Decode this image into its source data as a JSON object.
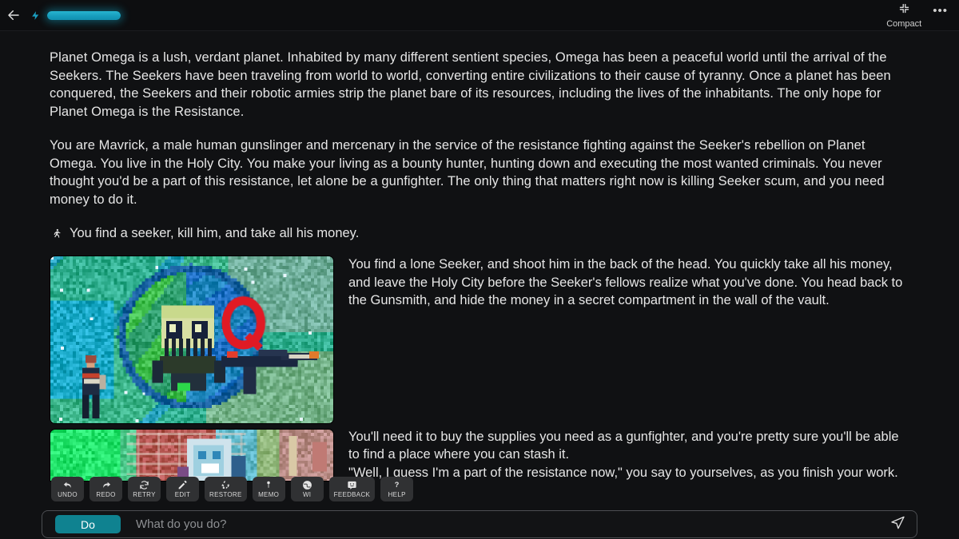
{
  "topbar": {
    "back_icon": "arrow-left-icon",
    "energy_icon": "lightning-bolt-icon",
    "energy_percent": 100,
    "compact_label": "Compact",
    "compact_icon": "compress-icon",
    "more_label": "•••"
  },
  "story": {
    "paragraph_1": "Planet Omega is a lush, verdant planet. Inhabited by many different sentient species, Omega has been a peaceful world until the arrival of the Seekers. The Seekers have been traveling from world to world, converting entire civilizations to their cause of tyranny. Once a planet has been conquered, the Seekers and their robotic armies strip the planet bare of its resources, including the lives of the inhabitants. The only hope for Planet Omega is the Resistance.",
    "paragraph_2": "You are Mavrick, a male human gunslinger and mercenary in the service of the resistance fighting against the Seeker's rebellion on Planet Omega. You live in the Holy City. You make your living as a bounty hunter, hunting down and executing the most wanted criminals. You never thought you'd be a part of this resistance, let alone be a gunfighter. The only thing that matters right now is killing Seeker scum, and you need money to do it.",
    "action_icon": "running-person-icon",
    "action_text": "You find a seeker, kill him, and take all his money.",
    "response_1": "You find a lone Seeker, and shoot him in the back of the head. You quickly take all his money, and leave the Holy City before the Seeker's fellows realize what you've done. You head back to the Gunsmith, and hide the money in a secret compartment in the wall of the vault.",
    "response_2": " You'll need it to buy the supplies you need as a gunfighter, and you're pretty sure you'll be able to find a place where you can stash it.",
    "response_3": "\"Well, I guess I'm a part of the resistance now,\" you say to yourselves, as you finish your work.",
    "image_1_alt": "pixel-art planet with skull face, red Q, gun and standing figure",
    "image_2_alt": "pixel-art scene with green field, brick wall and figure"
  },
  "toolbar": {
    "buttons": [
      {
        "label": "UNDO",
        "icon": "undo-arrow-icon"
      },
      {
        "label": "REDO",
        "icon": "redo-arrow-icon"
      },
      {
        "label": "RETRY",
        "icon": "refresh-cycle-icon"
      },
      {
        "label": "EDIT",
        "icon": "pencil-icon"
      },
      {
        "label": "RESTORE",
        "icon": "recycle-icon"
      },
      {
        "label": "MEMO",
        "icon": "pin-icon"
      },
      {
        "label": "WI",
        "icon": "globe-icon"
      },
      {
        "label": "FEEDBACK",
        "icon": "comment-face-icon"
      },
      {
        "label": "HELP",
        "icon": "question-mark-icon"
      }
    ]
  },
  "input": {
    "mode_label": "Do",
    "placeholder": "What do you do?",
    "value": "",
    "send_icon": "paper-plane-icon"
  },
  "colors": {
    "accent_teal": "#0f8290",
    "energy_cyan": "#1da5c4",
    "background": "#101113",
    "toolbar_button": "#303133"
  }
}
